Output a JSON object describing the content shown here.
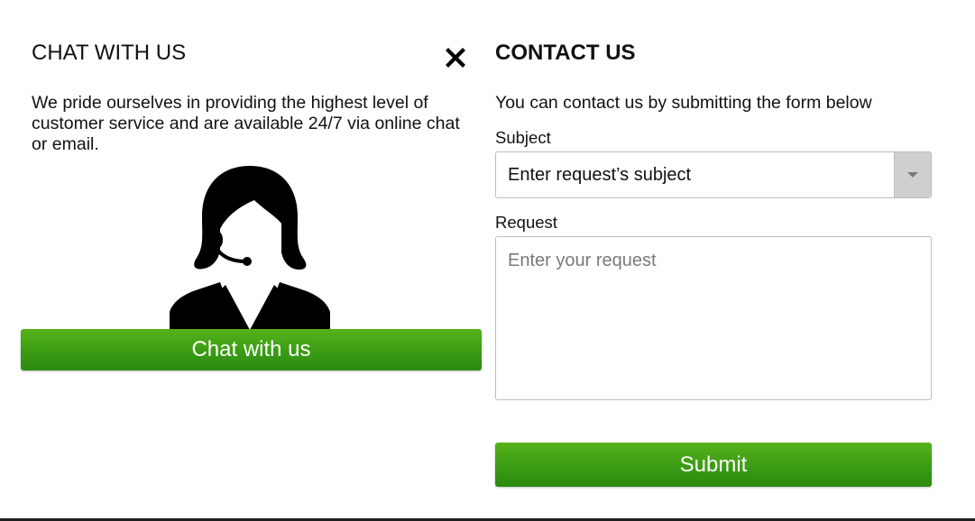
{
  "chat_panel": {
    "title": "CHAT WITH US",
    "description": "We pride ourselves in providing the highest level of customer service and are available 24/7 via online chat or email.",
    "agent_icon": "support-agent-headset-icon",
    "chat_button_label": "Chat with us"
  },
  "close_icon": "close-x-icon",
  "contact_panel": {
    "title": "CONTACT US",
    "description": "You can contact us by submitting the form below",
    "subject": {
      "label": "Subject",
      "value": "Enter request’s subject",
      "arrow_icon": "dropdown-caret-icon"
    },
    "request": {
      "label": "Request",
      "placeholder": "Enter your request",
      "value": ""
    },
    "submit_label": "Submit"
  },
  "colors": {
    "button_green_top": "#57b21a",
    "button_green_bottom": "#2a8a0f",
    "text": "#111111",
    "border": "#bdbdbd",
    "select_arrow_bg": "#cfcfcf"
  }
}
